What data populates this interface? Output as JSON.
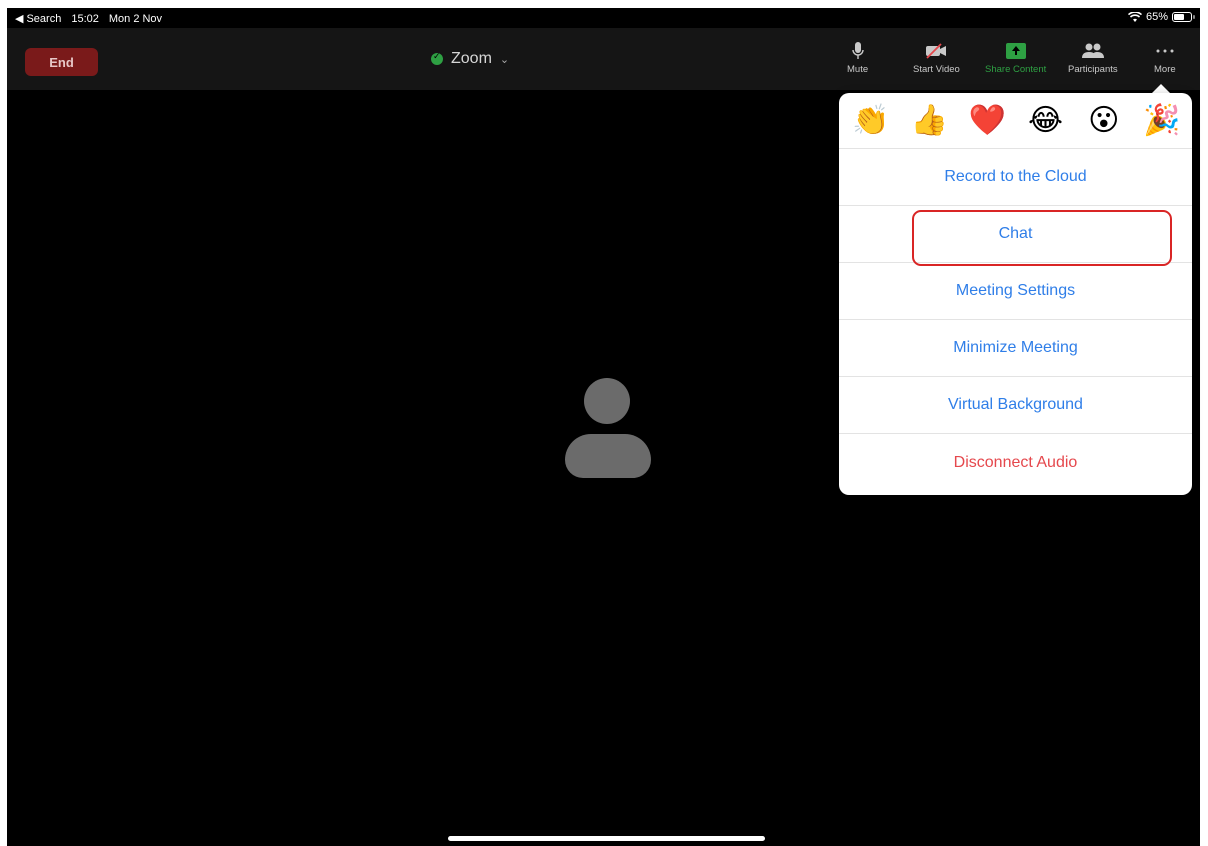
{
  "status_bar": {
    "back_label": "Search",
    "time": "15:02",
    "date": "Mon 2 Nov",
    "battery": "65%",
    "battery_level": 0.65
  },
  "toolbar": {
    "end_label": "End",
    "meeting_title": "Zoom",
    "buttons": [
      {
        "label": "Mute",
        "icon": "microphone-icon"
      },
      {
        "label": "Start Video",
        "icon": "video-off-icon"
      },
      {
        "label": "Share Content",
        "icon": "share-screen-icon",
        "color": "#2ea043"
      },
      {
        "label": "Participants",
        "icon": "participants-icon"
      },
      {
        "label": "More",
        "icon": "more-dots-icon"
      }
    ]
  },
  "reactions": [
    {
      "emoji": "👏",
      "name": "clap-reaction"
    },
    {
      "emoji": "👍",
      "name": "thumbs-up-reaction"
    },
    {
      "emoji": "❤️",
      "name": "heart-reaction"
    },
    {
      "emoji": "😂",
      "name": "laugh-reaction"
    },
    {
      "emoji": "😮",
      "name": "wow-reaction"
    },
    {
      "emoji": "🎉",
      "name": "party-reaction"
    }
  ],
  "menu": {
    "items": [
      {
        "label": "Record to the Cloud"
      },
      {
        "label": "Chat"
      },
      {
        "label": "Meeting Settings"
      },
      {
        "label": "Minimize Meeting"
      },
      {
        "label": "Virtual Background"
      },
      {
        "label": "Disconnect Audio"
      }
    ]
  },
  "colors": {
    "end_button": "#7a1a1a",
    "menu_text": "#2f7ee8",
    "danger_text": "#e5484d",
    "highlight": "#d92525",
    "shield": "#2ea043"
  }
}
